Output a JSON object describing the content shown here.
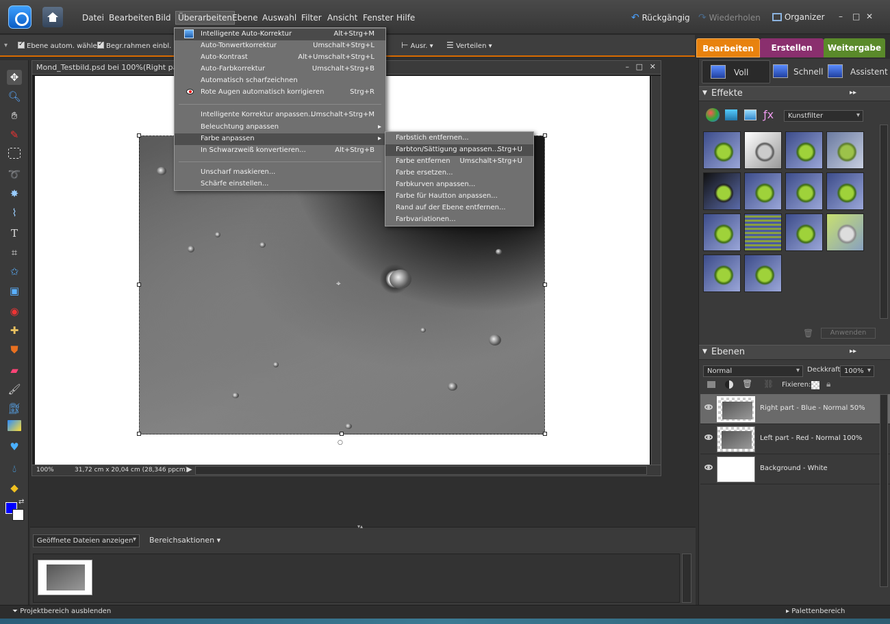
{
  "menubar": {
    "items": [
      "Datei",
      "Bearbeiten",
      "Bild",
      "Überarbeiten",
      "Ebene",
      "Auswahl",
      "Filter",
      "Ansicht",
      "Fenster",
      "Hilfe"
    ],
    "undo": "Rückgängig",
    "redo": "Wiederholen",
    "organizer": "Organizer"
  },
  "options": {
    "auto_select": "Ebene autom. wählen",
    "bounds": "Begr.rahmen einbl.",
    "align": "Ausr.",
    "distribute": "Verteilen"
  },
  "mode_tabs": [
    "Bearbeiten",
    "Erstellen",
    "Weitergabe"
  ],
  "mode_colors": {
    "bearbeiten": "#e8820e",
    "erstellen": "#8a2f6e",
    "weitergabe": "#5a8a2a"
  },
  "document": {
    "title": "Mond_Testbild.psd bei 100%(Right pa",
    "zoom": "100%",
    "size": "31,72 cm x 20,04 cm (28,346 ppcm)"
  },
  "enhance_menu": {
    "items": [
      {
        "label": "Intelligente Auto-Korrektur",
        "shortcut": "Alt+Strg+M"
      },
      {
        "label": "Auto-Tonwertkorrektur",
        "shortcut": "Umschalt+Strg+L"
      },
      {
        "label": "Auto-Kontrast",
        "shortcut": "Alt+Umschalt+Strg+L"
      },
      {
        "label": "Auto-Farbkorrektur",
        "shortcut": "Umschalt+Strg+B"
      },
      {
        "label": "Automatisch scharfzeichnen",
        "shortcut": ""
      },
      {
        "label": "Rote Augen automatisch korrigieren",
        "shortcut": "Strg+R"
      },
      {
        "label": "Intelligente Korrektur anpassen...",
        "shortcut": "Umschalt+Strg+M"
      },
      {
        "label": "Beleuchtung anpassen",
        "shortcut": ""
      },
      {
        "label": "Farbe anpassen",
        "shortcut": ""
      },
      {
        "label": "In Schwarzweiß konvertieren...",
        "shortcut": "Alt+Strg+B"
      },
      {
        "label": "Unscharf maskieren...",
        "shortcut": ""
      },
      {
        "label": "Schärfe einstellen...",
        "shortcut": ""
      }
    ]
  },
  "color_submenu": {
    "items": [
      {
        "label": "Farbstich entfernen...",
        "shortcut": ""
      },
      {
        "label": "Farbton/Sättigung anpassen...",
        "shortcut": "Strg+U"
      },
      {
        "label": "Farbe entfernen",
        "shortcut": "Umschalt+Strg+U"
      },
      {
        "label": "Farbe ersetzen...",
        "shortcut": ""
      },
      {
        "label": "Farbkurven anpassen...",
        "shortcut": ""
      },
      {
        "label": "Farbe für Hautton anpassen...",
        "shortcut": ""
      },
      {
        "label": "Rand auf der Ebene entfernen...",
        "shortcut": ""
      },
      {
        "label": "Farbvariationen...",
        "shortcut": ""
      }
    ]
  },
  "edit_modes": [
    "Voll",
    "Schnell",
    "Assistent"
  ],
  "effects": {
    "title": "Effekte",
    "filter_select": "Kunstfilter",
    "apply": "Anwenden"
  },
  "layers": {
    "title": "Ebenen",
    "blend_mode": "Normal",
    "opacity_label": "Deckkraft:",
    "opacity": "100%",
    "lock_label": "Fixieren:",
    "items": [
      {
        "name": "Right part - Blue - Normal 50%"
      },
      {
        "name": "Left part - Red - Normal 100%"
      },
      {
        "name": "Background - White"
      }
    ]
  },
  "project_bin": {
    "show_select": "Geöffnete Dateien anzeigen",
    "actions": "Bereichsaktionen"
  },
  "bottom": {
    "hide_bin": "Projektbereich ausblenden",
    "palette_bin": "Palettenbereich"
  },
  "colors": {
    "foreground": "#0000ff",
    "background": "#ffffff"
  }
}
